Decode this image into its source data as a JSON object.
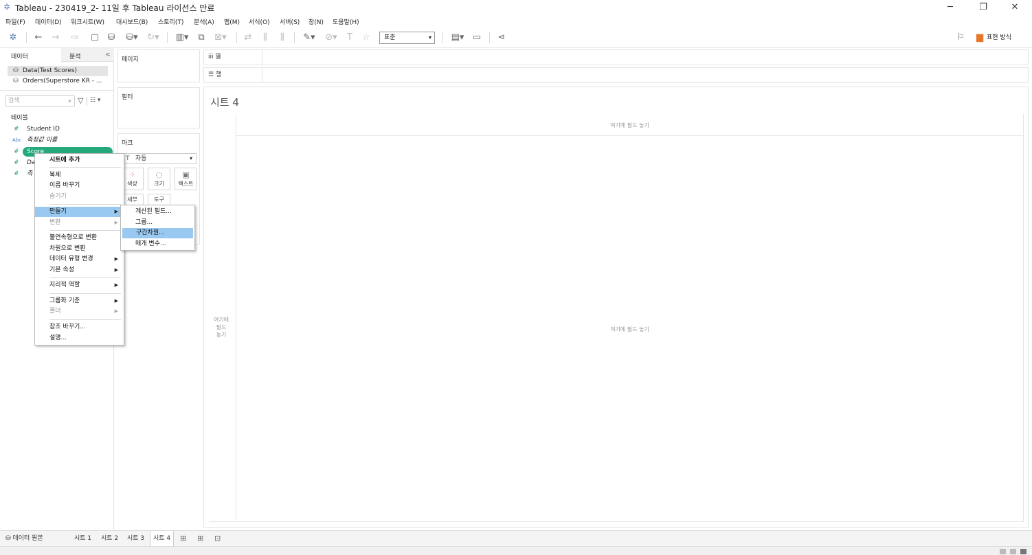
{
  "window": {
    "title": "Tableau - 230419_2- 11일 후 Tableau 라이선스 만료",
    "minimize": "─",
    "restore": "❐",
    "close": "✕"
  },
  "menubar": [
    "파일(F)",
    "데이터(D)",
    "워크시트(W)",
    "대시보드(B)",
    "스토리(T)",
    "분석(A)",
    "맵(M)",
    "서식(O)",
    "서버(S)",
    "창(N)",
    "도움말(H)"
  ],
  "toolbar": {
    "fit_value": "표준",
    "show_me_label": "표현 방식"
  },
  "datapane": {
    "tab_data": "데이터",
    "tab_analysis": "분석",
    "collapse": "<",
    "datasources": [
      "Data(Test Scores)",
      "Orders(Superstore KR - ..."
    ],
    "search_placeholder": "검색",
    "section_tables": "테이블",
    "fields": [
      {
        "icon": "#",
        "name": "Student ID",
        "italic": false
      },
      {
        "icon": "Abc",
        "name": "측정값 이름",
        "italic": true
      },
      {
        "icon": "#",
        "name": "Score",
        "italic": false,
        "selected": true
      },
      {
        "icon": "#",
        "name": "Da",
        "italic": true
      },
      {
        "icon": "#",
        "name": "측",
        "italic": true
      }
    ]
  },
  "shelves": {
    "pages": "페이지",
    "filters": "필터",
    "marks": "마크",
    "mark_type": "자동",
    "mark_buttons": [
      "색상",
      "크기",
      "텍스트",
      "세부",
      "도구"
    ],
    "columns": "열",
    "rows": "행"
  },
  "canvas": {
    "sheet_title": "시트 4",
    "drop_top": "여기에 필드 놓기",
    "drop_left": "여기에\n필드\n놓기",
    "drop_center": "여기에 필드 놓기"
  },
  "context_menu": {
    "items": [
      {
        "label": "시트에 추가",
        "bold": true
      },
      {
        "label": "복제"
      },
      {
        "label": "이름 바꾸기"
      },
      {
        "label": "숨기기",
        "disabled": true
      },
      {
        "label": "만들기",
        "submenu": true,
        "highlighted": true
      },
      {
        "label": "변환",
        "submenu": true,
        "disabled": true
      },
      {
        "label": "불연속형으로 변환"
      },
      {
        "label": "차원으로 변환"
      },
      {
        "label": "데이터 유형 변경",
        "submenu": true
      },
      {
        "label": "기본 속성",
        "submenu": true
      },
      {
        "label": "지리적 역할",
        "submenu": true
      },
      {
        "label": "그룹화 기준",
        "submenu": true
      },
      {
        "label": "폴더",
        "submenu": true,
        "disabled": true
      },
      {
        "label": "참조 바꾸기..."
      },
      {
        "label": "설명..."
      }
    ]
  },
  "submenu": {
    "items": [
      "계산된 필드...",
      "그룹...",
      "구간차원...",
      "매개 변수..."
    ],
    "highlighted_index": 2
  },
  "tabs": {
    "datasource": "데이터 원본",
    "sheets": [
      "시트 1",
      "시트 2",
      "시트 3",
      "시트 4"
    ],
    "active_index": 3
  }
}
